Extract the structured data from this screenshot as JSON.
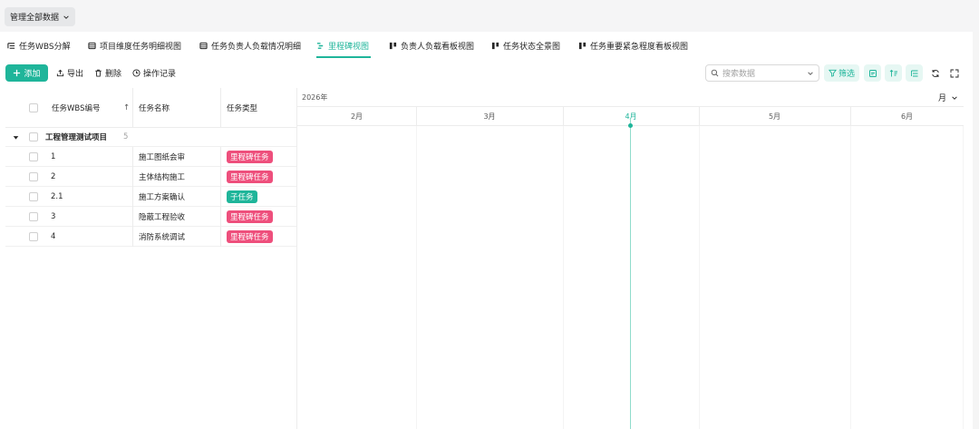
{
  "view_select": {
    "label": "管理全部数据"
  },
  "tabs": [
    {
      "label": "任务WBS分解",
      "icon": "tree-list-icon"
    },
    {
      "label": "项目维度任务明细视图",
      "icon": "table-icon"
    },
    {
      "label": "任务负责人负载情况明细",
      "icon": "table-icon"
    },
    {
      "label": "里程碑视图",
      "icon": "gantt-icon",
      "active": true
    },
    {
      "label": "负责人负载看板视图",
      "icon": "kanban-icon"
    },
    {
      "label": "任务状态全景图",
      "icon": "kanban-icon"
    },
    {
      "label": "任务重要紧急程度看板视图",
      "icon": "kanban-icon"
    }
  ],
  "toolbar": {
    "add_label": "添加",
    "export_label": "导出",
    "delete_label": "删除",
    "history_label": "操作记录",
    "search_placeholder": "搜索数据",
    "filter_label": "筛选"
  },
  "table": {
    "columns": [
      "任务WBS编号",
      "任务名称",
      "任务类型"
    ],
    "sort_indicator": "↑",
    "group": {
      "name": "工程管理测试项目",
      "count": "5"
    },
    "rows": [
      {
        "wbs": "1",
        "name": "施工图纸会审",
        "type": "里程碑任务",
        "type_color": "#ee4f7c"
      },
      {
        "wbs": "2",
        "name": "主体结构施工",
        "type": "里程碑任务",
        "type_color": "#ee4f7c"
      },
      {
        "wbs": "2.1",
        "name": "施工方案确认",
        "type": "子任务",
        "type_color": "#1fb59a"
      },
      {
        "wbs": "3",
        "name": "隐蔽工程验收",
        "type": "里程碑任务",
        "type_color": "#ee4f7c"
      },
      {
        "wbs": "4",
        "name": "消防系统调试",
        "type": "里程碑任务",
        "type_color": "#ee4f7c"
      }
    ]
  },
  "gantt": {
    "year": "2026年",
    "scale": "月",
    "months": [
      "2月",
      "3月",
      "4月",
      "5月",
      "6月"
    ],
    "today_month": "4月"
  },
  "colors": {
    "accent": "#1fb59a",
    "milestone": "#ee4f7c"
  }
}
